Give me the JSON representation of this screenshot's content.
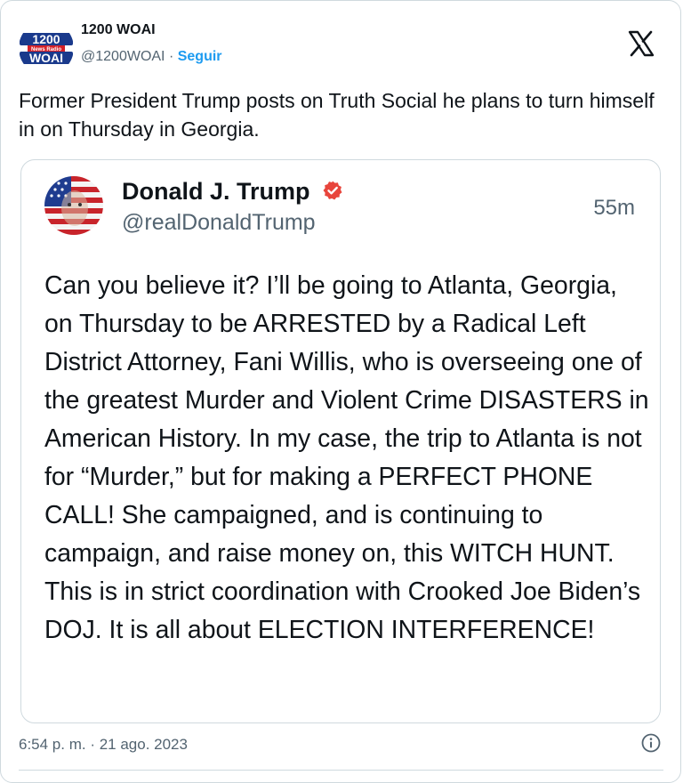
{
  "tweet": {
    "author": {
      "name": "1200 WOAI",
      "handle": "@1200WOAI",
      "separator": "·",
      "follow_label": "Seguir",
      "logo_top": "1200",
      "logo_mid": "News Radio",
      "logo_bottom": "WOAI"
    },
    "text": "Former President Trump posts on Truth Social he plans to turn himself in on Thursday in Georgia.",
    "timestamp": "6:54 p. m. · 21 ago. 2023",
    "icons": {
      "platform": "x-logo-icon",
      "info": "info-icon"
    }
  },
  "quoted_post": {
    "name": "Donald J. Trump",
    "handle": "@realDonaldTrump",
    "time": "55m",
    "verified_color": "#e8453c",
    "body": "Can you believe it? I’ll be going to Atlanta, Georgia, on Thursday to be ARRESTED by a Radical Left District Attorney, Fani Willis, who is overseeing one of the greatest Murder and Violent Crime DISASTERS in American History. In my case, the trip to Atlanta is not for “Murder,” but for making a PERFECT PHONE CALL! She campaigned, and is continuing to campaign, and raise money on, this WITCH HUNT. This is in strict coordination with Crooked Joe Biden’s DOJ. It is all about ELECTION INTERFERENCE!"
  },
  "colors": {
    "link": "#1d9bf0",
    "muted": "#536471",
    "border": "#cfd9de",
    "woai_blue": "#1a3a8c",
    "woai_red": "#d42027"
  }
}
